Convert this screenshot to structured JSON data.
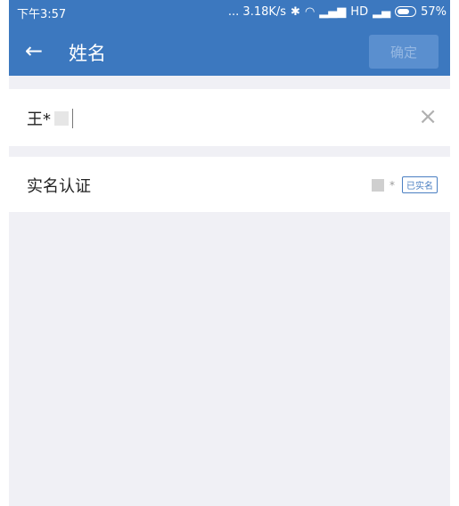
{
  "status_bar": {
    "time": "下午3:57",
    "network_speed": "... 3.18K/s",
    "network": "HD",
    "battery": "57%"
  },
  "nav": {
    "title": "姓名",
    "confirm_label": "确定"
  },
  "name_input": {
    "value": "王*"
  },
  "verify": {
    "label": "实名认证",
    "masked_name": "*",
    "badge": "已实名"
  },
  "colors": {
    "primary": "#3c78bf",
    "background": "#f0f0f5",
    "badge": "#4a7fc2"
  }
}
